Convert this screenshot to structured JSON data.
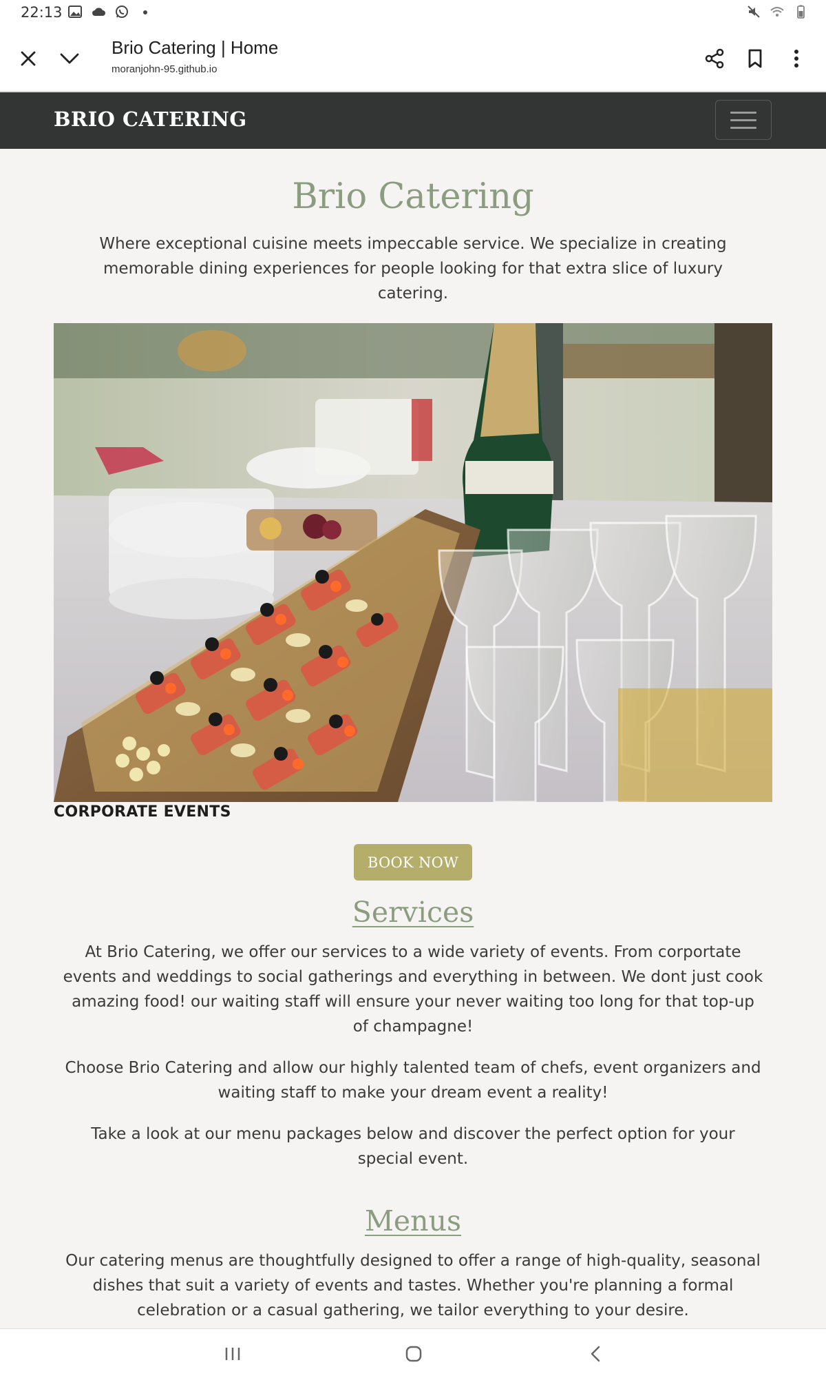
{
  "status_bar": {
    "time": "22:13",
    "left_icons": [
      "image-icon",
      "cloud-icon",
      "whatsapp-icon",
      "dot-icon"
    ],
    "right_icons": [
      "mute-icon",
      "wifi-icon",
      "battery-icon"
    ]
  },
  "browser": {
    "title": "Brio Catering | Home",
    "url": "moranjohn-95.github.io"
  },
  "navbar": {
    "brand": "BRIO CATERING"
  },
  "hero": {
    "title": "Brio Catering",
    "subtitle": "Where exceptional cuisine meets impeccable service. We specialize in creating memorable dining experiences for people looking for that extra slice of luxury catering.",
    "image_caption": "CORPORATE EVENTS",
    "book_button": "BOOK NOW"
  },
  "services": {
    "heading": "Services",
    "paragraphs": [
      "At Brio Catering, we offer our services to a wide variety of events. From corportate events and weddings to social gatherings and everything in between. We dont just cook amazing food! our waiting staff will ensure your never waiting too long for that top-up of champagne!",
      "Choose Brio Catering and allow our highly talented team of chefs, event organizers and waiting staff to make your dream event a reality!",
      "Take a look at our menu packages below and discover the perfect option for your special event."
    ]
  },
  "menus": {
    "heading": "Menus",
    "paragraphs": [
      "Our catering menus are thoughtfully designed to offer a range of high-quality, seasonal dishes that suit a variety of events and tastes. Whether you're planning a formal celebration or a casual gathering, we tailor everything to your desire."
    ]
  },
  "colors": {
    "accent_green": "#8a9d7f",
    "button_gold": "#b5ad6a",
    "navbar_dark": "#333434",
    "page_bg": "#f6f4f2"
  }
}
